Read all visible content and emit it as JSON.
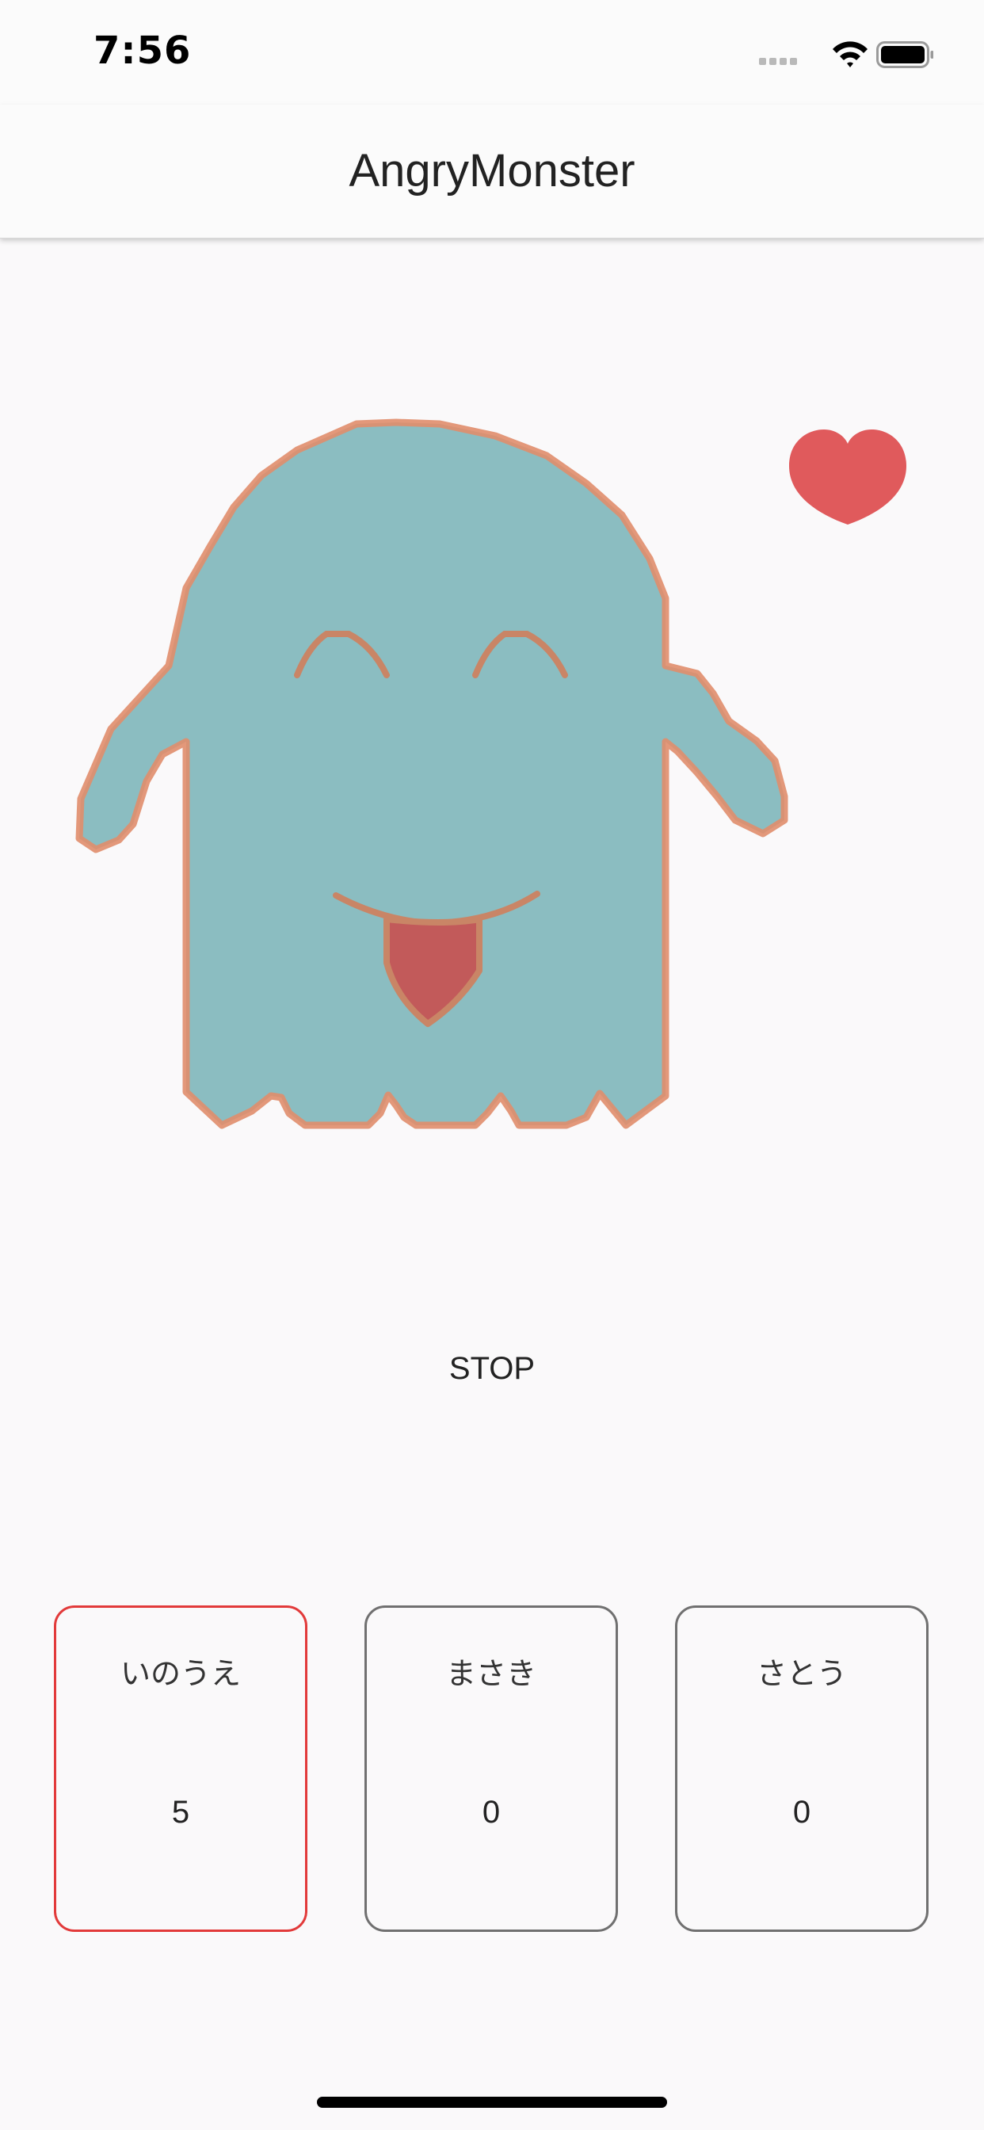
{
  "status_bar": {
    "time": "7:56",
    "icons": [
      "cellular-signal-icon",
      "wifi-icon",
      "battery-icon"
    ]
  },
  "nav": {
    "title": "AngryMonster"
  },
  "monster": {
    "icon": "smiling-ghost-monster-illustration",
    "body_color": "#8bbdc1",
    "outline_color": "#e08d6b",
    "tongue_color": "#c25a5a"
  },
  "heart": {
    "icon": "heart-icon",
    "color": "#e05a5c"
  },
  "controls": {
    "stop_label": "STOP"
  },
  "players": [
    {
      "name": "いのうえ",
      "score": "5",
      "active": true
    },
    {
      "name": "まさき",
      "score": "0",
      "active": false
    },
    {
      "name": "さとう",
      "score": "0",
      "active": false
    }
  ],
  "colors": {
    "active_border": "#e23a3a",
    "inactive_border": "#707070",
    "background": "#faf9fa"
  }
}
